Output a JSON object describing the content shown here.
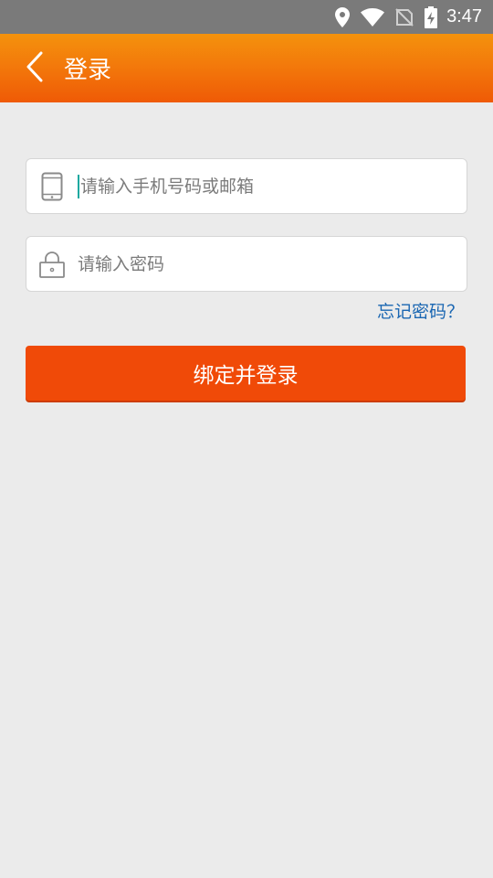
{
  "status_bar": {
    "time": "3:47",
    "icons": [
      "location-icon",
      "wifi-icon",
      "no-sim-icon",
      "battery-charging-icon"
    ]
  },
  "app_bar": {
    "back_icon": "chevron-left-icon",
    "title": "登录"
  },
  "form": {
    "account": {
      "icon": "phone-icon",
      "placeholder": "请输入手机号码或邮箱",
      "value": ""
    },
    "password": {
      "icon": "lock-icon",
      "placeholder": "请输入密码",
      "value": ""
    },
    "forgot_label": "忘记密码？",
    "submit_label": "绑定并登录"
  },
  "colors": {
    "app_bar_top": "#f4920c",
    "app_bar_bottom": "#ef5a06",
    "primary_button": "#f04a08",
    "link": "#1a66b2",
    "background": "#ebebeb"
  }
}
